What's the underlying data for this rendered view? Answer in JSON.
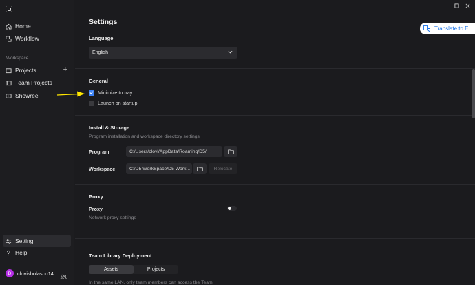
{
  "sidebar": {
    "nav": [
      {
        "label": "Home",
        "icon": "home-icon"
      },
      {
        "label": "Workflow",
        "icon": "workflow-icon"
      }
    ],
    "section_label": "Workspace",
    "workspace": [
      {
        "label": "Projects",
        "icon": "projects-icon"
      },
      {
        "label": "Team Projects",
        "icon": "team-projects-icon"
      },
      {
        "label": "Showreel",
        "icon": "showreel-icon"
      }
    ],
    "bottom": [
      {
        "label": "Setting",
        "icon": "setting-icon"
      },
      {
        "label": "Help",
        "icon": "help-icon"
      }
    ],
    "user": {
      "initial": "D",
      "name": "clovisbolasco14..."
    }
  },
  "settings": {
    "title": "Settings",
    "language": {
      "title": "Language",
      "value": "English"
    },
    "general": {
      "title": "General",
      "minimize_to_tray": {
        "label": "Minimize to tray",
        "checked": true
      },
      "launch_on_startup": {
        "label": "Launch on startup",
        "checked": false
      }
    },
    "install": {
      "title": "Install & Storage",
      "desc": "Program installation and workspace directory settings",
      "program_label": "Program",
      "program_path": "C:/Users/clovi/AppData/Roaming/D5/",
      "workspace_label": "Workspace",
      "workspace_path": "C:/D5 WorkSpace/D5 Work...",
      "relocate_label": "Relocate"
    },
    "proxy": {
      "title": "Proxy",
      "label": "Proxy",
      "desc": "Network proxy settings",
      "enabled": false
    },
    "team_library": {
      "title": "Team Library Deployment",
      "tabs": [
        "Assets",
        "Projects"
      ],
      "active_tab": "Assets",
      "desc": "In the same LAN, only team members can access the Team"
    }
  },
  "translate_chip": {
    "label": "Translate to E"
  },
  "colors": {
    "accent": "#3b82f6",
    "avatar": "#b62fe6",
    "arrow": "#ffe600",
    "translate": "#1a73e8"
  }
}
